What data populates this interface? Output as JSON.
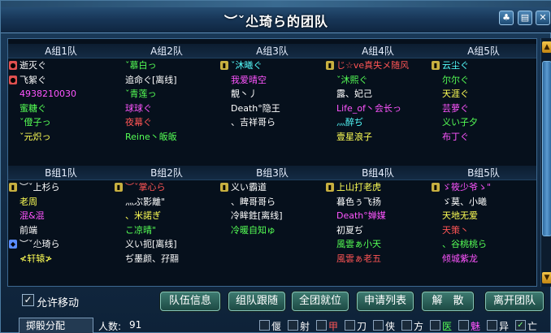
{
  "window": {
    "title": "︶ˇ尐琦ら的团队"
  },
  "groups_a": [
    {
      "header": "A组1队",
      "members": [
        {
          "name": "逝灭ぐ",
          "color": "#ffffff",
          "icon": "avatar-icon"
        },
        {
          "name": "飞絮ぐ",
          "color": "#ffffff",
          "icon": "avatar-icon"
        },
        {
          "name": "4938210030",
          "color": "#ff55ff"
        },
        {
          "name": "蜜糖ぐ",
          "color": "#55ff55"
        },
        {
          "name": "ˇ僜子っ",
          "color": "#55ff55"
        },
        {
          "name": "ˇ元炽っ",
          "color": "#ffff55"
        }
      ]
    },
    {
      "header": "A组2队",
      "members": [
        {
          "name": "ˇ慕白っ",
          "color": "#55ff55"
        },
        {
          "name": "追命ぐ[离线]",
          "color": "#ffffff"
        },
        {
          "name": "ˇ青莲っ",
          "color": "#55ff55"
        },
        {
          "name": "球球ぐ",
          "color": "#ff55ff"
        },
        {
          "name": "夜幕ぐ",
          "color": "#ff5555"
        },
        {
          "name": "Reine丶皈皈",
          "color": "#55ff55"
        }
      ]
    },
    {
      "header": "A组3队",
      "members": [
        {
          "name": "ˇ沐曦ぐ",
          "color": "#55ffff",
          "icon": "flag-icon"
        },
        {
          "name": "我爱晴空",
          "color": "#ff55ff"
        },
        {
          "name": "靚丶丿",
          "color": "#ffffff"
        },
        {
          "name": "Death°隐王",
          "color": "#ffffff"
        },
        {
          "name": "、吉祥哥ら",
          "color": "#ffffff"
        }
      ]
    },
    {
      "header": "A组4队",
      "members": [
        {
          "name": "じ☆ve真失メ随风",
          "color": "#ff5555",
          "icon": "flag-icon"
        },
        {
          "name": "ˇ沐熙ぐ",
          "color": "#55ff55"
        },
        {
          "name": "露、妃己",
          "color": "#ffffff"
        },
        {
          "name": "Life_of丶会长っ",
          "color": "#ff55ff"
        },
        {
          "name": "灬醉ぢ",
          "color": "#55ffff"
        },
        {
          "name": "壹星浪子",
          "color": "#ffff55"
        }
      ]
    },
    {
      "header": "A组5队",
      "members": [
        {
          "name": "云尘ぐ",
          "color": "#55ffff",
          "icon": "flag-icon"
        },
        {
          "name": "尔尔ぐ",
          "color": "#55ff55"
        },
        {
          "name": "天涯ぐ",
          "color": "#ffff55"
        },
        {
          "name": "芸萝ぐ",
          "color": "#ff55ff"
        },
        {
          "name": "义い子夕",
          "color": "#55ff55"
        },
        {
          "name": "布丁ぐ",
          "color": "#ff55ff"
        }
      ]
    }
  ],
  "groups_b": [
    {
      "header": "B组1队",
      "members": [
        {
          "name": "︶ˇ上杉ら",
          "color": "#ffffff",
          "icon": "flag-icon"
        },
        {
          "name": "老周",
          "color": "#ffff55"
        },
        {
          "name": "混&混",
          "color": "#ff55ff"
        },
        {
          "name": "前端",
          "color": "#ffffff"
        },
        {
          "name": "︶ˇ尐琦ら",
          "color": "#ffffff",
          "icon": "shield-icon"
        },
        {
          "name": "≮轩辕≯",
          "color": "#ffff55"
        }
      ]
    },
    {
      "header": "B组2队",
      "members": [
        {
          "name": "︶ˇ掌心ら",
          "color": "#ff5555",
          "icon": "flag-icon"
        },
        {
          "name": "灬ぷ影離\"",
          "color": "#ffffff"
        },
        {
          "name": "、米諾ぎ",
          "color": "#ffff55"
        },
        {
          "name": "こ凉晴\"",
          "color": "#55ff55"
        },
        {
          "name": "义い扼[离线]",
          "color": "#ffffff"
        },
        {
          "name": "ぢ墨颜、孖翮",
          "color": "#ffffff"
        }
      ]
    },
    {
      "header": "B组3队",
      "members": [
        {
          "name": "义い霸道",
          "color": "#ffffff",
          "icon": "flag-icon"
        },
        {
          "name": "、睥哥哥ら",
          "color": "#ffffff"
        },
        {
          "name": "冷眸鉎[离线]",
          "color": "#ffffff"
        },
        {
          "name": "冷暖自知ゅ",
          "color": "#55ff55"
        }
      ]
    },
    {
      "header": "B组4队",
      "members": [
        {
          "name": "上山打老虎",
          "color": "#ffff55",
          "icon": "flag-icon"
        },
        {
          "name": "暮色ぅ飞扬",
          "color": "#ffffff"
        },
        {
          "name": "Death°婵媒",
          "color": "#ff55ff"
        },
        {
          "name": "初夏ぢ",
          "color": "#ffffff"
        },
        {
          "name": "風雲ぁ小天",
          "color": "#55ff55"
        },
        {
          "name": "風雲ぁ老五",
          "color": "#ff5555"
        }
      ]
    },
    {
      "header": "B组5队",
      "members": [
        {
          "name": "ゞ筱少爷ゝ\"",
          "color": "#ff55ff",
          "icon": "flag-icon"
        },
        {
          "name": "ゞ莫、小曦",
          "color": "#ffffff"
        },
        {
          "name": "天地无爱",
          "color": "#ffff55"
        },
        {
          "name": "天策丶",
          "color": "#ff5555"
        },
        {
          "name": "、谷桃桃ら",
          "color": "#55ff55"
        },
        {
          "name": "倾城紫龙",
          "color": "#ff55ff"
        }
      ]
    }
  ],
  "controls": {
    "allow_move_label": "允许移动",
    "allow_move_checked": true,
    "buttons": [
      "队伍信息",
      "组队跟随",
      "全团就位",
      "申请列表",
      "解　散",
      "离开团队"
    ]
  },
  "status": {
    "dropdown_value": "掷骰分配",
    "count_label": "人数:",
    "count_value": "91",
    "filters": [
      {
        "label": "偃",
        "color": "#ffffff",
        "checked": false
      },
      {
        "label": "射",
        "color": "#ffffff",
        "checked": false
      },
      {
        "label": "甲",
        "color": "#ff5555",
        "checked": false
      },
      {
        "label": "刀",
        "color": "#ffffff",
        "checked": false
      },
      {
        "label": "侠",
        "color": "#ffffff",
        "checked": false
      },
      {
        "label": "方",
        "color": "#ffffff",
        "checked": false
      },
      {
        "label": "医",
        "color": "#55ff55",
        "checked": false
      },
      {
        "label": "魅",
        "color": "#ff55ff",
        "checked": false
      },
      {
        "label": "异",
        "color": "#ffffff",
        "checked": false
      },
      {
        "label": "亡",
        "color": "#ffffff",
        "checked": true
      }
    ]
  }
}
